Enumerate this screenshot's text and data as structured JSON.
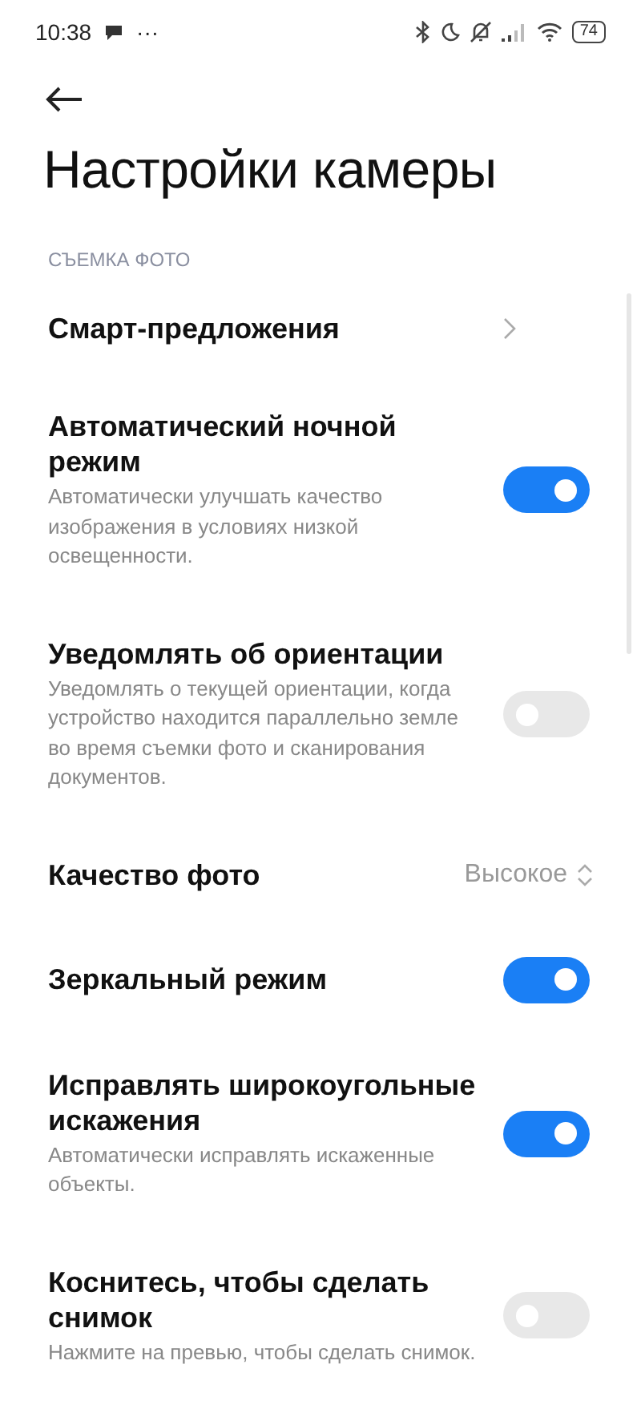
{
  "status_bar": {
    "time": "10:38",
    "more": "···",
    "battery": "74"
  },
  "title": "Настройки камеры",
  "section": "СЪЕМКА ФОТО",
  "items": [
    {
      "kind": "link",
      "title": "Смарт-предложения"
    },
    {
      "kind": "toggle",
      "title": "Автоматический ночной режим",
      "description": "Автоматически улучшать качество изображения в условиях низкой освещенности.",
      "on": true
    },
    {
      "kind": "toggle",
      "title": "Уведомлять об ориентации",
      "description": "Уведомлять о текущей ориентации, когда устройство находится параллельно земле во время съемки фото и сканирования документов.",
      "on": false
    },
    {
      "kind": "select",
      "title": "Качество фото",
      "value": "Высокое"
    },
    {
      "kind": "toggle",
      "title": "Зеркальный режим",
      "on": true
    },
    {
      "kind": "toggle",
      "title": "Исправлять широкоугольные искажения",
      "description": "Автоматически исправлять искаженные объекты.",
      "on": true
    },
    {
      "kind": "toggle",
      "title": "Коснитесь, чтобы сделать снимок",
      "description": "Нажмите на превью, чтобы сделать снимок.",
      "on": false
    }
  ]
}
